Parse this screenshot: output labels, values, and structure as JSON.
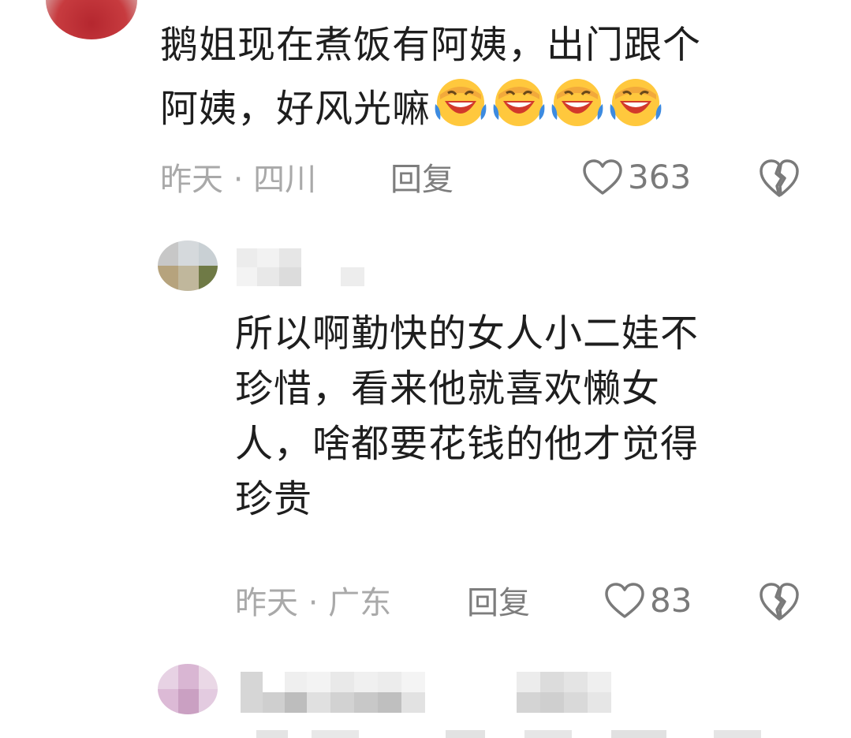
{
  "comments": [
    {
      "text_line1": "鹅姐现在煮饭有阿姨，出门跟个",
      "text_line2": "阿姨，好风光嘛",
      "emoji_count": 4,
      "time": "昨天",
      "location": "四川",
      "meta_sep": "·",
      "reply_label": "回复",
      "likes": "363"
    },
    {
      "text_lines": [
        "所以啊勤快的女人小二娃不",
        "珍惜，看来他就喜欢懒女",
        "人，啥都要花钱的他才觉得",
        "珍贵"
      ],
      "time": "昨天",
      "location": "广东",
      "meta_sep": "·",
      "reply_label": "回复",
      "likes": "83"
    }
  ],
  "icons": {
    "emoji": "laugh-cry-emoji-icon",
    "like": "heart-icon",
    "dislike": "broken-heart-icon"
  },
  "colors": {
    "text": "#1e1e1e",
    "meta": "#a9a9a9",
    "icon": "#7a7a7a"
  }
}
